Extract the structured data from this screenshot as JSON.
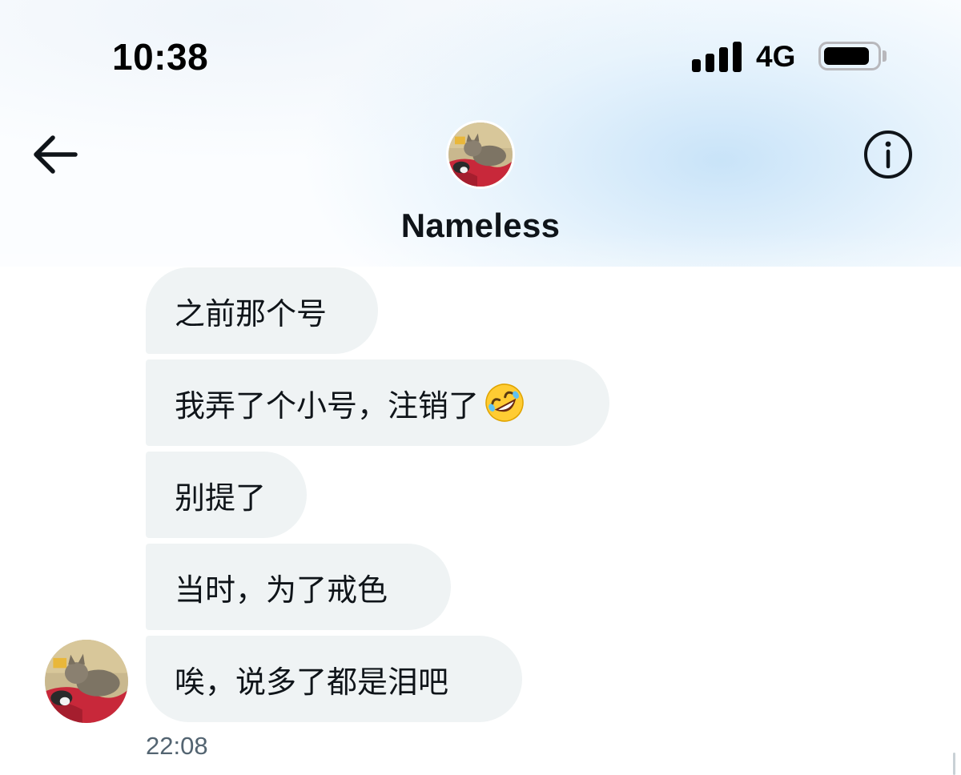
{
  "status_bar": {
    "time": "10:38",
    "network": "4G",
    "battery_level": 0.88,
    "signal_bars": 4
  },
  "header": {
    "back_icon": "arrow-left-icon",
    "info_icon": "info-circle-icon",
    "contact_name": "Nameless",
    "avatar_icon": "cat-photo-avatar"
  },
  "conversation": {
    "messages": [
      {
        "text": "之前那个号"
      },
      {
        "text": "我弄了个小号，注销了",
        "emoji": "rolling-on-floor-laughing-emoji"
      },
      {
        "text": "别提了"
      },
      {
        "text": "当时，为了戒色"
      },
      {
        "text": "唉，说多了都是泪吧"
      }
    ],
    "timestamp": "22:08"
  },
  "colors": {
    "bubble_background": "#eff3f4",
    "text_primary": "#0f1419",
    "text_secondary": "#536471",
    "header_tint": "#c6e2f8"
  }
}
